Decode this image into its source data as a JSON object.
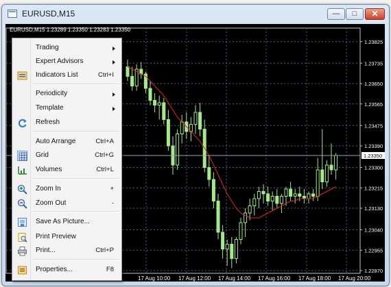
{
  "window": {
    "title": "EURUSD,M15",
    "min_glyph": "—",
    "max_glyph": "□",
    "close_glyph": "✕"
  },
  "chart": {
    "symbol_info": "EURUSD,M15  1.23289 1.23350 1.23283 1.23350",
    "current_price": "1.23350",
    "price_labels": [
      "1.23825",
      "1.23735",
      "1.23650",
      "1.23565",
      "1.23475",
      "1.23390",
      "1.23300",
      "1.23215",
      "1.23130",
      "1.23040",
      "1.22955",
      "1.22870"
    ],
    "time_labels": [
      "17 Aug 10:00",
      "17 Aug 12:00",
      "17 Aug 14:00",
      "17 Aug 16:00",
      "17 Aug 18:00",
      "17 Aug 20:00"
    ],
    "colors": {
      "background": "#000000",
      "bull": "#a6e88c",
      "bear": "#a6e88c",
      "ma": "#e0262b",
      "grid": "#56657a",
      "axis_text": "#ffffff"
    }
  },
  "chart_data": {
    "type": "candlestick",
    "symbol": "EURUSD",
    "timeframe": "M15",
    "current_price": 1.2335,
    "ylim": [
      1.2287,
      1.2387
    ],
    "y_ticks": [
      1.23825,
      1.23735,
      1.2365,
      1.23565,
      1.23475,
      1.2339,
      1.233,
      1.23215,
      1.2313,
      1.2304,
      1.22955,
      1.2287
    ],
    "x_ticks": [
      "17 Aug 10:00",
      "17 Aug 12:00",
      "17 Aug 14:00",
      "17 Aug 16:00",
      "17 Aug 18:00",
      "17 Aug 20:00"
    ],
    "ohlc": [
      [
        1.2372,
        1.2375,
        1.2366,
        1.2368
      ],
      [
        1.2368,
        1.2372,
        1.2362,
        1.2364
      ],
      [
        1.2364,
        1.2373,
        1.2362,
        1.2371
      ],
      [
        1.2371,
        1.2374,
        1.2367,
        1.2369
      ],
      [
        1.2369,
        1.237,
        1.2361,
        1.2363
      ],
      [
        1.2363,
        1.2366,
        1.2356,
        1.2358
      ],
      [
        1.2358,
        1.2361,
        1.2353,
        1.2356
      ],
      [
        1.2356,
        1.236,
        1.235,
        1.2357
      ],
      [
        1.2357,
        1.2359,
        1.2348,
        1.235
      ],
      [
        1.235,
        1.2354,
        1.2337,
        1.2339
      ],
      [
        1.2339,
        1.2343,
        1.2327,
        1.2331
      ],
      [
        1.2331,
        1.2346,
        1.2329,
        1.2344
      ],
      [
        1.2344,
        1.2352,
        1.234,
        1.2349
      ],
      [
        1.2349,
        1.2353,
        1.2342,
        1.2345
      ],
      [
        1.2345,
        1.2351,
        1.2341,
        1.2348
      ],
      [
        1.2348,
        1.2356,
        1.2344,
        1.2353
      ],
      [
        1.2353,
        1.2357,
        1.2343,
        1.2346
      ],
      [
        1.2346,
        1.235,
        1.2328,
        1.233
      ],
      [
        1.233,
        1.2335,
        1.2322,
        1.2325
      ],
      [
        1.2325,
        1.2328,
        1.2313,
        1.2316
      ],
      [
        1.2316,
        1.2319,
        1.23,
        1.2303
      ],
      [
        1.2303,
        1.2306,
        1.2292,
        1.2296
      ],
      [
        1.2296,
        1.23,
        1.2289,
        1.2298
      ],
      [
        1.2298,
        1.2301,
        1.2288,
        1.2292
      ],
      [
        1.2292,
        1.2301,
        1.229,
        1.23
      ],
      [
        1.23,
        1.2309,
        1.2298,
        1.2307
      ],
      [
        1.2307,
        1.2313,
        1.2301,
        1.2311
      ],
      [
        1.2311,
        1.2317,
        1.2308,
        1.2314
      ],
      [
        1.2314,
        1.2319,
        1.231,
        1.2317
      ],
      [
        1.2317,
        1.2322,
        1.2313,
        1.232
      ],
      [
        1.232,
        1.2323,
        1.2315,
        1.2319
      ],
      [
        1.2319,
        1.2322,
        1.2314,
        1.2316
      ],
      [
        1.2316,
        1.232,
        1.2312,
        1.2318
      ],
      [
        1.2318,
        1.2321,
        1.2313,
        1.2315
      ],
      [
        1.2315,
        1.2319,
        1.2311,
        1.2318
      ],
      [
        1.2318,
        1.2322,
        1.2314,
        1.2321
      ],
      [
        1.2321,
        1.2324,
        1.2316,
        1.2318
      ],
      [
        1.2318,
        1.2321,
        1.2315,
        1.2319
      ],
      [
        1.2319,
        1.2322,
        1.2316,
        1.2318
      ],
      [
        1.2318,
        1.2321,
        1.2315,
        1.2317
      ],
      [
        1.2317,
        1.232,
        1.2315,
        1.2319
      ],
      [
        1.2319,
        1.2321,
        1.2316,
        1.2318
      ],
      [
        1.2318,
        1.2334,
        1.2316,
        1.2329
      ],
      [
        1.2329,
        1.2346,
        1.2321,
        1.2324
      ],
      [
        1.2324,
        1.2333,
        1.2322,
        1.2331
      ],
      [
        1.2331,
        1.234,
        1.2327,
        1.2329
      ],
      [
        1.2329,
        1.2336,
        1.2325,
        1.2335
      ]
    ],
    "moving_average": [
      1.2372,
      1.2371,
      1.237,
      1.2369,
      1.2368,
      1.2366,
      1.2364,
      1.2362,
      1.236,
      1.2357,
      1.2354,
      1.2351,
      1.2349,
      1.2347,
      1.2345,
      1.2343,
      1.2341,
      1.2338,
      1.2335,
      1.2331,
      1.2327,
      1.2323,
      1.2319,
      1.2316,
      1.2313,
      1.2311,
      1.231,
      1.2309,
      1.2309,
      1.2309,
      1.231,
      1.2311,
      1.2312,
      1.2313,
      1.2314,
      1.2315,
      1.2316,
      1.2316,
      1.2317,
      1.2317,
      1.2317,
      1.2317,
      1.2318,
      1.2319,
      1.232,
      1.2321,
      1.2322
    ]
  },
  "context_menu": {
    "items": [
      {
        "name": "menu-item-trading",
        "label": "Trading",
        "shortcut": "",
        "submenu": true,
        "icon": "",
        "checked": false
      },
      {
        "name": "menu-item-expert-advisors",
        "label": "Expert Advisors",
        "shortcut": "",
        "submenu": true,
        "icon": "",
        "checked": false
      },
      {
        "name": "menu-item-indicators-list",
        "label": "Indicators List",
        "shortcut": "Ctrl+I",
        "submenu": false,
        "icon": "indicators-list-icon",
        "checked": false
      },
      {
        "name": "menu-item-periodicity",
        "label": "Periodicity",
        "shortcut": "",
        "submenu": true,
        "icon": "",
        "checked": false
      },
      {
        "name": "menu-item-template",
        "label": "Template",
        "shortcut": "",
        "submenu": true,
        "icon": "",
        "checked": false
      },
      {
        "name": "menu-item-refresh",
        "label": "Refresh",
        "shortcut": "",
        "submenu": false,
        "icon": "refresh-icon",
        "checked": false
      },
      {
        "name": "menu-item-auto-arrange",
        "label": "Auto Arrange",
        "shortcut": "Ctrl+A",
        "submenu": false,
        "icon": "",
        "checked": false
      },
      {
        "name": "menu-item-grid",
        "label": "Grid",
        "shortcut": "Ctrl+G",
        "submenu": false,
        "icon": "grid-icon",
        "checked": true
      },
      {
        "name": "menu-item-volumes",
        "label": "Volumes",
        "shortcut": "Ctrl+L",
        "submenu": false,
        "icon": "volumes-icon",
        "checked": false
      },
      {
        "name": "menu-item-zoom-in",
        "label": "Zoom In",
        "shortcut": "+",
        "submenu": false,
        "icon": "zoom-in-icon",
        "checked": false
      },
      {
        "name": "menu-item-zoom-out",
        "label": "Zoom Out",
        "shortcut": "-",
        "submenu": false,
        "icon": "zoom-out-icon",
        "checked": false
      },
      {
        "name": "menu-item-save-as-picture",
        "label": "Save As Picture...",
        "shortcut": "",
        "submenu": false,
        "icon": "save-picture-icon",
        "checked": false
      },
      {
        "name": "menu-item-print-preview",
        "label": "Print Preview",
        "shortcut": "",
        "submenu": false,
        "icon": "print-preview-icon",
        "checked": false
      },
      {
        "name": "menu-item-print",
        "label": "Print...",
        "shortcut": "Ctrl+P",
        "submenu": false,
        "icon": "printer-icon",
        "checked": false
      },
      {
        "name": "menu-item-properties",
        "label": "Properties...",
        "shortcut": "F8",
        "submenu": false,
        "icon": "properties-icon",
        "checked": false
      }
    ]
  }
}
